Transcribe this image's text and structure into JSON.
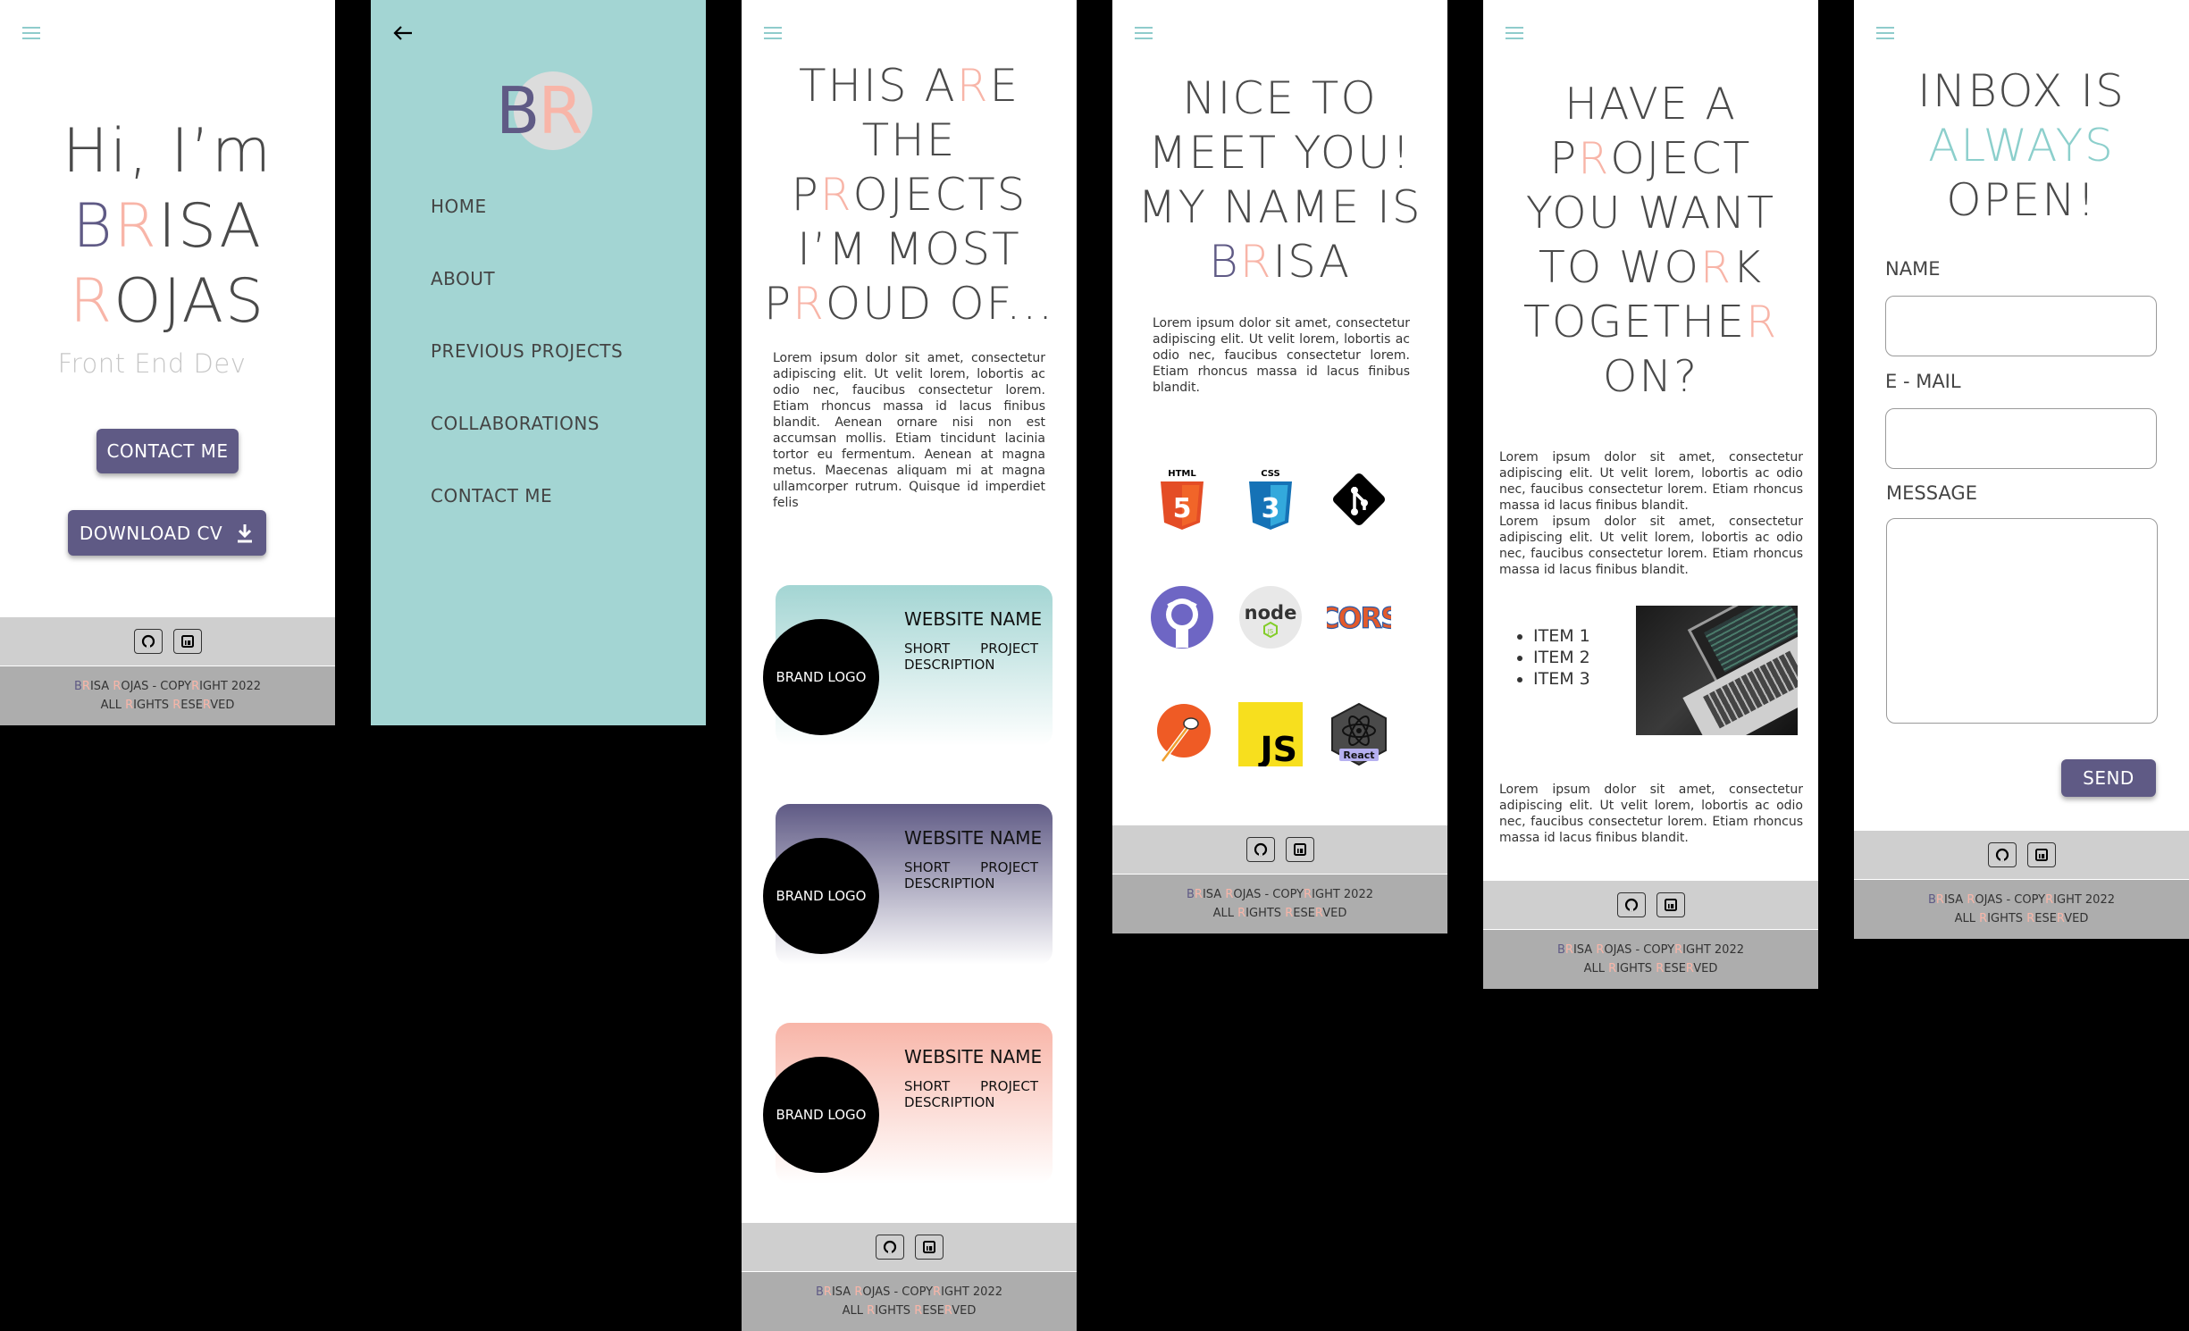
{
  "colors": {
    "pink": "#f8b5a8",
    "purple": "#5f5a85",
    "teal": "#a3d5d3"
  },
  "home": {
    "greeting": "Hi, I’m",
    "name_first_parts": [
      "B",
      "R",
      "ISA"
    ],
    "name_last_parts": [
      "R",
      "OJAS"
    ],
    "role": "Front End Dev",
    "contact_button": "CONTACT ME",
    "download_button": "DOWNLOAD CV"
  },
  "footer": {
    "line1_parts": [
      "B",
      "R",
      "ISA ",
      "R",
      "OJAS - COPY",
      "R",
      "IGHT 2022"
    ],
    "line2_parts": [
      "ALL ",
      "R",
      "IGHTS ",
      "R",
      "ESE",
      "R",
      "VED"
    ],
    "icons": [
      "github-icon",
      "linkedin-icon"
    ]
  },
  "menu": {
    "logo": "BR",
    "items": [
      "HOME",
      "ABOUT",
      "PREVIOUS PROJECTS",
      "COLLABORATIONS",
      "CONTACT ME"
    ]
  },
  "projects": {
    "title_lines": [
      [
        "THIS A",
        "R",
        "E"
      ],
      [
        "THE"
      ],
      [
        "P",
        "R",
        "OJECTS"
      ],
      [
        "I’M MOST"
      ],
      [
        "P",
        "R",
        "OUD OF..."
      ]
    ],
    "body": "Lorem ipsum dolor sit amet, consectetur adipiscing elit. Ut velit lorem, lobortis ac odio nec, faucibus consectetur lorem. Etiam rhoncus massa id lacus finibus blandit. Aenean ornare nisi non est accumsan mollis. Etiam tincidunt lacinia tortor eu fermentum. Aenean at magna metus. Maecenas aliquam mi at magna ullamcorper rutrum. Quisque id imperdiet felis",
    "cards": [
      {
        "logo": "BRAND LOGO",
        "name": "WEBSITE NAME",
        "desc": "SHORT PROJECT DESCRIPTION"
      },
      {
        "logo": "BRAND LOGO",
        "name": "WEBSITE NAME",
        "desc": "SHORT PROJECT DESCRIPTION"
      },
      {
        "logo": "BRAND LOGO",
        "name": "WEBSITE NAME",
        "desc": "SHORT PROJECT DESCRIPTION"
      }
    ]
  },
  "about": {
    "title_lines": [
      [
        "NICE TO"
      ],
      [
        "MEET YOU!"
      ],
      [
        "MY NAME IS"
      ],
      [
        "B",
        "R",
        "ISA"
      ]
    ],
    "body": "Lorem ipsum dolor sit amet, consectetur adipiscing elit. Ut velit lorem, lobortis ac odio nec, faucibus consectetur lorem. Etiam rhoncus massa id lacus finibus blandit.",
    "tech": [
      "html5-icon",
      "css3-icon",
      "git-icon",
      "github-icon",
      "nodejs-icon",
      "cors-icon",
      "postman-icon",
      "javascript-icon",
      "react-icon"
    ],
    "tech_labels": {
      "html": "HTML",
      "css": "CSS",
      "js": "JS",
      "react": "React",
      "node": "node",
      "cors": "CORS"
    }
  },
  "collab": {
    "title_lines": [
      [
        "HAVE A"
      ],
      [
        "P",
        "R",
        "OJECT"
      ],
      [
        "YOU WANT"
      ],
      [
        "TO WO",
        "R",
        "K"
      ],
      [
        "TOGETHE",
        "R"
      ],
      [
        "ON?"
      ]
    ],
    "body1": "Lorem ipsum dolor sit amet, consectetur adipiscing elit. Ut velit lorem, lobortis ac odio nec, faucibus consectetur lorem. Etiam rhoncus massa id lacus finibus blandit.",
    "body2": "Lorem ipsum dolor sit amet, consectetur adipiscing elit. Ut velit lorem, lobortis ac odio nec, faucibus consectetur lorem. Etiam rhoncus massa id lacus finibus blandit.",
    "items": [
      "ITEM 1",
      "ITEM 2",
      "ITEM 3"
    ],
    "body3": "Lorem ipsum dolor sit amet, consectetur adipiscing elit. Ut velit lorem, lobortis ac odio nec, faucibus consectetur lorem. Etiam rhoncus massa id lacus finibus blandit."
  },
  "contact": {
    "title_line1": "INBOX IS",
    "title_line2": "ALWAYS",
    "title_line3": "OPEN!",
    "name_label": "NAME",
    "email_label": "E - MAIL",
    "message_label": "MESSAGE",
    "send_button": "SEND"
  }
}
